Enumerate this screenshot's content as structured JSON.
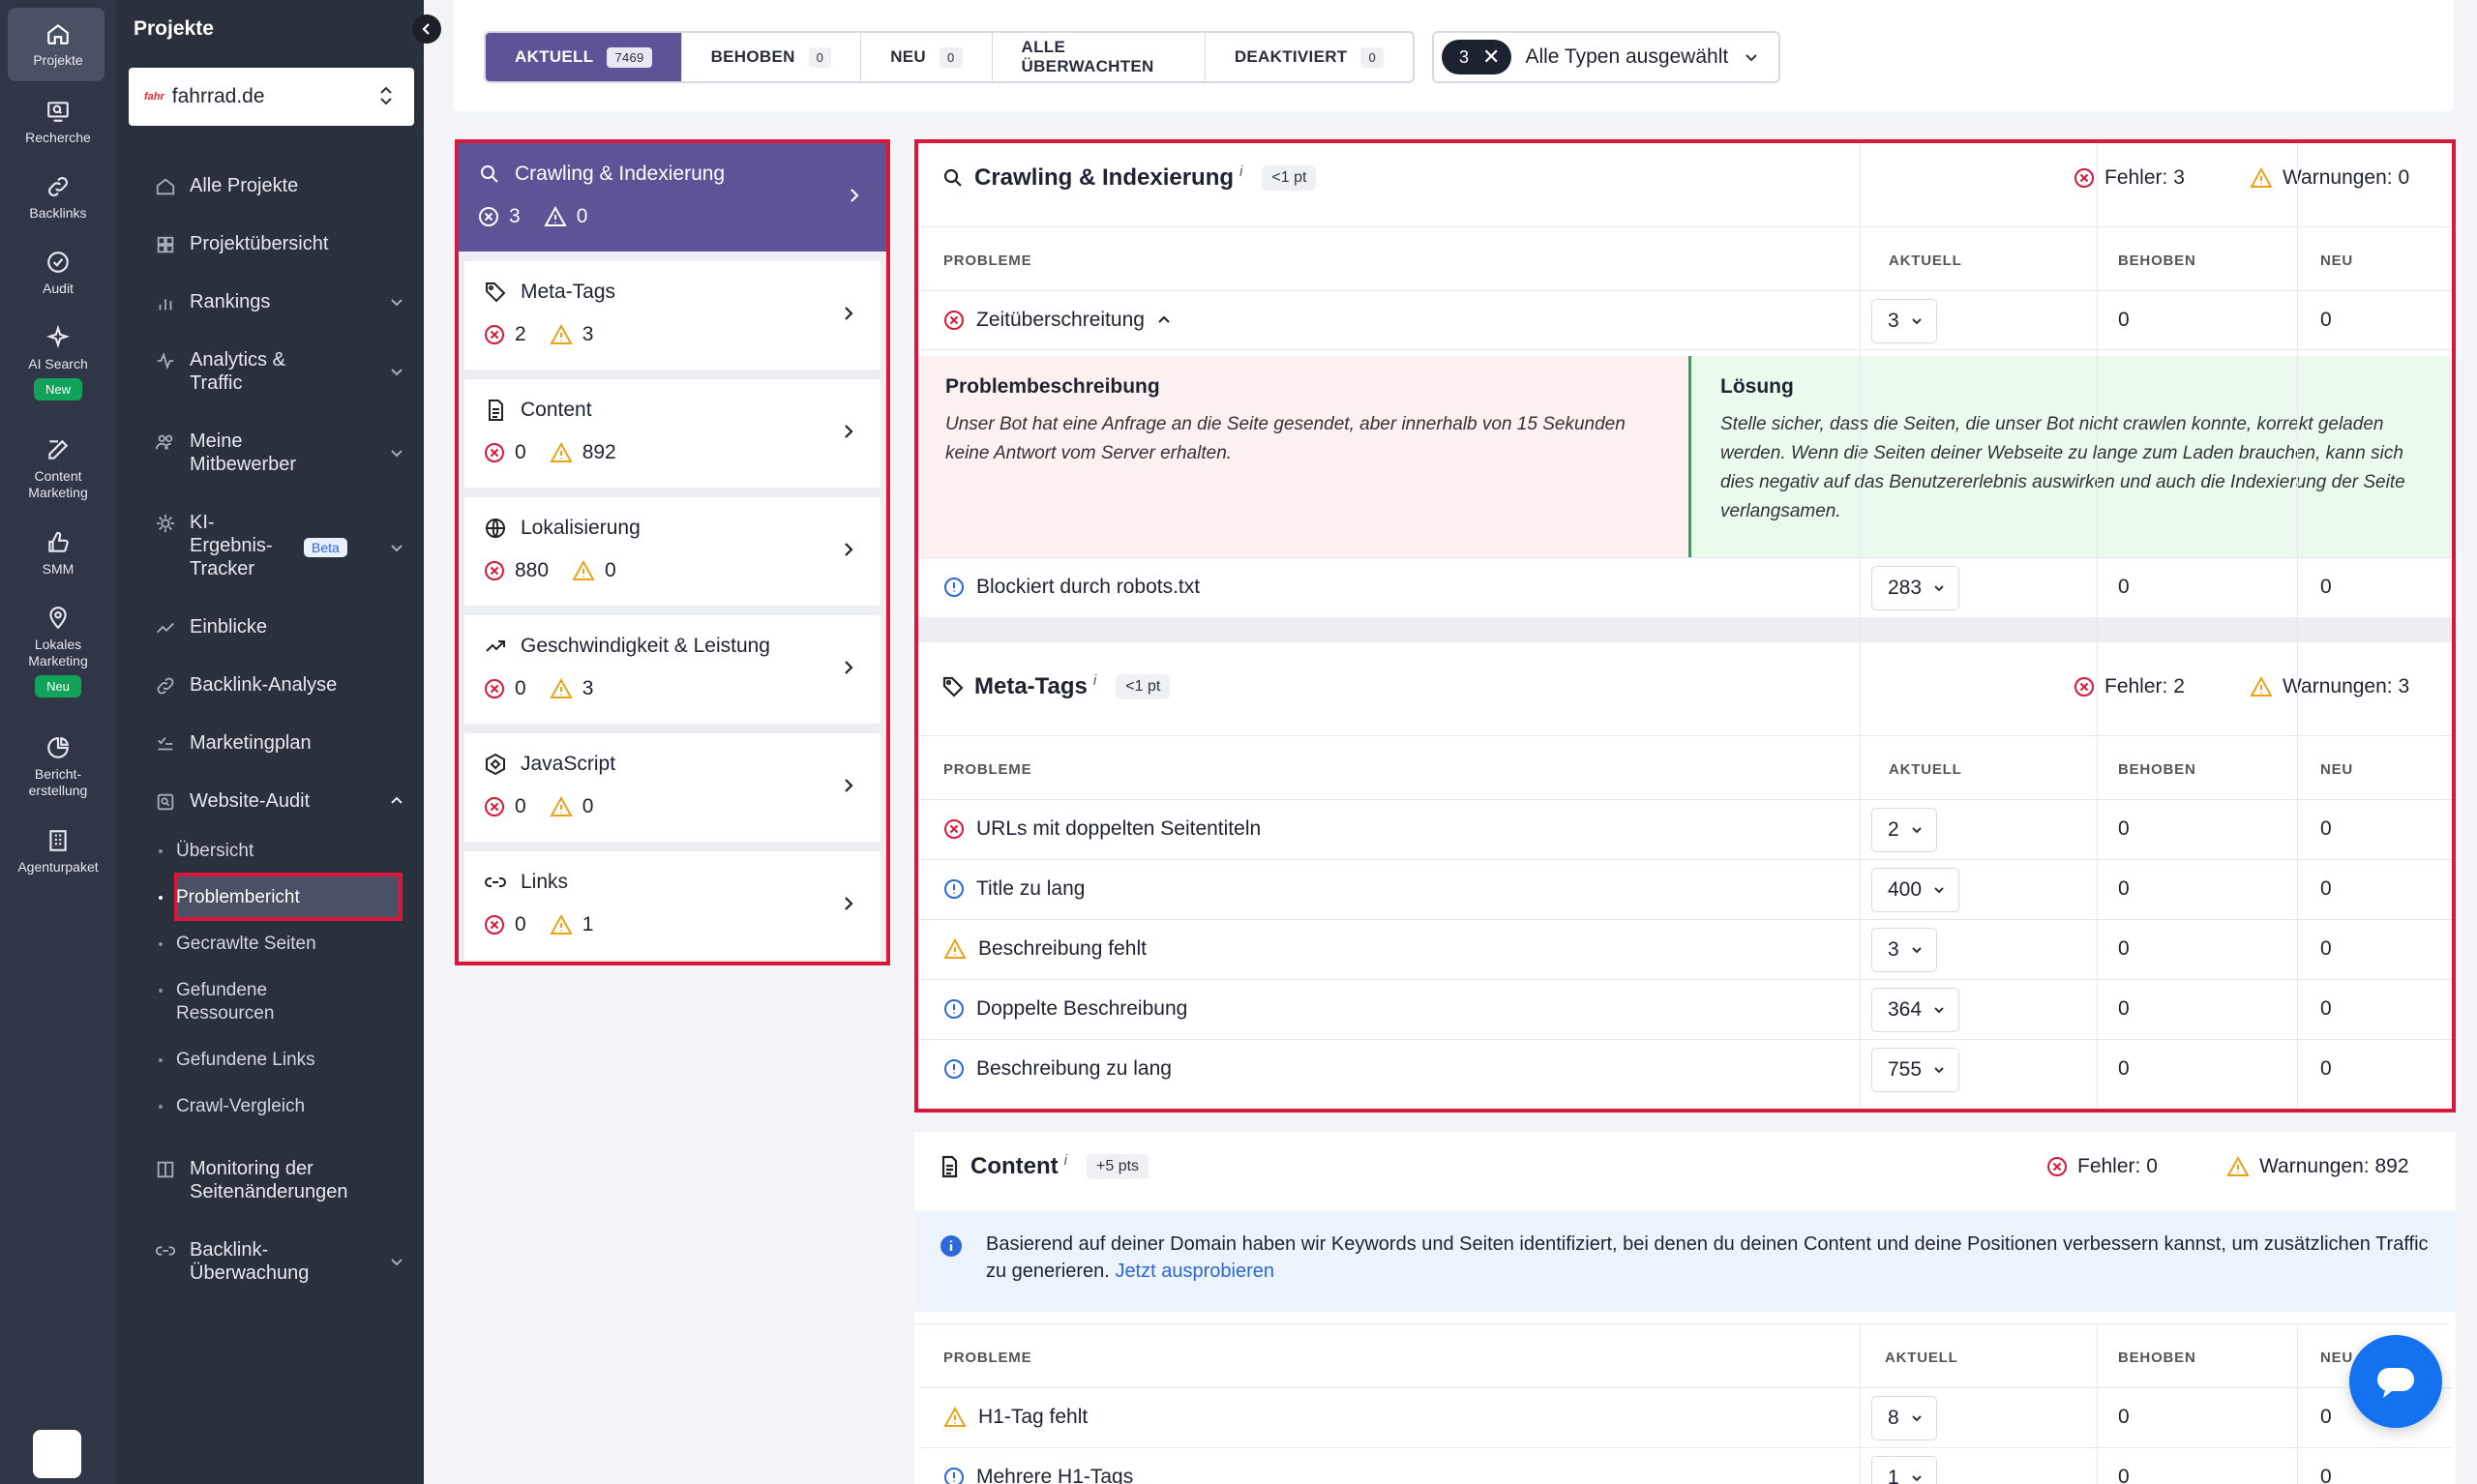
{
  "rail": {
    "items": [
      {
        "label": "Projekte"
      },
      {
        "label": "Recherche"
      },
      {
        "label": "Backlinks"
      },
      {
        "label": "Audit"
      },
      {
        "label": "AI Search",
        "badge": "New"
      },
      {
        "label": "Content Marketing"
      },
      {
        "label": "SMM"
      },
      {
        "label": "Lokales Marketing",
        "badge": "Neu"
      },
      {
        "label": "Bericht-erstellung"
      },
      {
        "label": "Agenturpaket"
      }
    ]
  },
  "nav": {
    "title": "Projekte",
    "project": "fahrrad.de",
    "project_logo": "fahr",
    "items": [
      {
        "label": "Alle Projekte"
      },
      {
        "label": "Projektübersicht"
      },
      {
        "label": "Rankings"
      },
      {
        "label": "Analytics & Traffic"
      },
      {
        "label": "Meine Mitbewerber"
      },
      {
        "label": "KI-Ergebnis-Tracker",
        "badge": "Beta"
      },
      {
        "label": "Einblicke"
      },
      {
        "label": "Backlink-Analyse"
      },
      {
        "label": "Marketingplan"
      },
      {
        "label": "Website-Audit"
      },
      {
        "label": "Monitoring der Seitenänderungen"
      },
      {
        "label": "Backlink-Überwachung"
      }
    ],
    "subitems": [
      {
        "label": "Übersicht"
      },
      {
        "label": "Problembericht"
      },
      {
        "label": "Gecrawlte Seiten"
      },
      {
        "label": "Gefundene Ressourcen"
      },
      {
        "label": "Gefundene Links"
      },
      {
        "label": "Crawl-Vergleich"
      }
    ]
  },
  "filters": {
    "tabs": [
      {
        "label": "AKTUELL",
        "count": "7469"
      },
      {
        "label": "BEHOBEN",
        "count": "0"
      },
      {
        "label": "NEU",
        "count": "0"
      },
      {
        "label": "ALLE ÜBERWACHTEN",
        "count": ""
      },
      {
        "label": "DEAKTIVIERT",
        "count": "0"
      }
    ],
    "type_count": "3",
    "type_label": "Alle Typen ausgewählt"
  },
  "categories": [
    {
      "title": "Crawling & Indexierung",
      "errors": "3",
      "warnings": "0",
      "icon": "search-icon"
    },
    {
      "title": "Meta-Tags",
      "errors": "2",
      "warnings": "3",
      "icon": "tag-icon"
    },
    {
      "title": "Content",
      "errors": "0",
      "warnings": "892",
      "icon": "document-icon"
    },
    {
      "title": "Lokalisierung",
      "errors": "880",
      "warnings": "0",
      "icon": "globe-icon"
    },
    {
      "title": "Geschwindigkeit & Leistung",
      "errors": "0",
      "warnings": "3",
      "icon": "trend-icon"
    },
    {
      "title": "JavaScript",
      "errors": "0",
      "warnings": "0",
      "icon": "js-icon"
    },
    {
      "title": "Links",
      "errors": "0",
      "warnings": "1",
      "icon": "link-icon"
    }
  ],
  "table_headers": {
    "problem": "PROBLEME",
    "current": "AKTUELL",
    "fixed": "BEHOBEN",
    "new": "NEU"
  },
  "sections": {
    "crawling": {
      "title": "Crawling & Indexierung",
      "sup": "i",
      "pts": "<1 pt",
      "errors_label": "Fehler: 3",
      "warnings_label": "Warnungen: 0",
      "rows": [
        {
          "name": "Zeitüberschreitung",
          "current": "3",
          "fixed": "0",
          "new": "0",
          "type": "error"
        },
        {
          "name": "Blockiert durch robots.txt",
          "current": "283",
          "fixed": "0",
          "new": "0",
          "type": "info"
        }
      ],
      "description_title": "Problembeschreibung",
      "description": "Unser Bot hat eine Anfrage an die Seite gesendet, aber innerhalb von 15 Sekunden keine Antwort vom Server erhalten.",
      "solution_title": "Lösung",
      "solution": "Stelle sicher, dass die Seiten, die unser Bot nicht crawlen konnte, korrekt geladen werden. Wenn die Seiten deiner Webseite zu lange zum Laden brauchen, kann sich dies negativ auf das Benutzererlebnis auswirken und auch die Indexierung der Seite verlangsamen."
    },
    "meta": {
      "title": "Meta-Tags",
      "sup": "i",
      "pts": "<1 pt",
      "errors_label": "Fehler: 2",
      "warnings_label": "Warnungen: 3",
      "rows": [
        {
          "name": "URLs mit doppelten Seitentiteln",
          "current": "2",
          "fixed": "0",
          "new": "0",
          "type": "error"
        },
        {
          "name": "Title zu lang",
          "current": "400",
          "fixed": "0",
          "new": "0",
          "type": "info"
        },
        {
          "name": "Beschreibung fehlt",
          "current": "3",
          "fixed": "0",
          "new": "0",
          "type": "warning"
        },
        {
          "name": "Doppelte Beschreibung",
          "current": "364",
          "fixed": "0",
          "new": "0",
          "type": "info"
        },
        {
          "name": "Beschreibung zu lang",
          "current": "755",
          "fixed": "0",
          "new": "0",
          "type": "info"
        }
      ]
    },
    "content": {
      "title": "Content",
      "sup": "i",
      "pts": "+5 pts",
      "errors_label": "Fehler: 0",
      "warnings_label": "Warnungen: 892",
      "info": "Basierend auf deiner Domain haben wir Keywords und Seiten identifiziert, bei denen du deinen Content und deine Positionen verbessern kannst, um zusätzlichen Traffic zu generieren.",
      "info_link": "Jetzt ausprobieren",
      "rows": [
        {
          "name": "H1-Tag fehlt",
          "current": "8",
          "fixed": "0",
          "new": "0",
          "type": "warning"
        },
        {
          "name": "Mehrere H1-Tags",
          "current": "1",
          "fixed": "0",
          "new": "0",
          "type": "info"
        }
      ]
    }
  },
  "colors": {
    "accent": "#5d5396",
    "highlight": "#d8183a",
    "error": "#d8183a",
    "warning": "#e8a317",
    "info": "#2c68d8"
  }
}
